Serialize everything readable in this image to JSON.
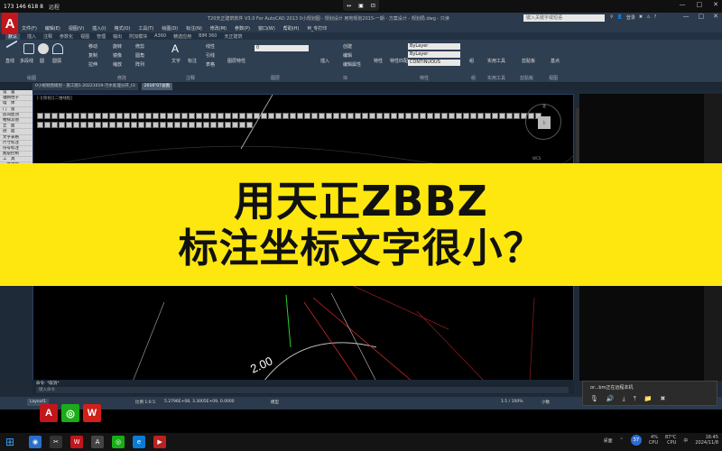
{
  "remote": {
    "id": "173 146 618 8",
    "tag": "远程",
    "center_icons": [
      "↔",
      "▣",
      "⊡"
    ],
    "panel_text": "or...bm正在远程本机",
    "panel_icons": [
      "🎙",
      "🔊",
      "⤓",
      "⤒",
      "📁",
      "✖"
    ]
  },
  "cad": {
    "logo": "A",
    "title": "T20天正建筑软件 V3.0 For AutoCAD 2013    0小规划图 - 规划设计 用地规划2015-一期 - 方案设计 - 规划局.dwg - 只读",
    "search_placeholder": "键入关键字或短语",
    "title_icons": [
      "⚲",
      "👤",
      "登录",
      "✖",
      "⚠",
      "?"
    ],
    "window_controls": [
      "—",
      "□",
      "✕"
    ],
    "menus": [
      "文件(F)",
      "编辑(E)",
      "视图(V)",
      "插入(I)",
      "格式(O)",
      "工具(T)",
      "绘图(D)",
      "标注(N)",
      "修改(M)",
      "参数(P)",
      "窗口(W)",
      "帮助(H)",
      "M_专打印"
    ],
    "ribbon_tabs": [
      "默认",
      "插入",
      "注释",
      "参数化",
      "视图",
      "管理",
      "输出",
      "附加模块",
      "A360",
      "精选应用",
      "BIM 360",
      "天正建筑"
    ],
    "ribbon": {
      "line": "直线",
      "polyline": "多段线",
      "circle": "圆",
      "arc": "圆弧",
      "move": "移动",
      "rotate": "旋转",
      "trim": "修剪",
      "copy": "复制",
      "mirror": "镜像",
      "fillet": "圆角",
      "stretch": "拉伸",
      "scale": "缩放",
      "array": "阵列",
      "text": "文字",
      "dim": "标注",
      "linear": "线性",
      "leader": "引线",
      "table": "表格",
      "layer_props": "图层特性",
      "layer_combo": "0",
      "insert": "插入",
      "create": "创建",
      "edit": "编辑",
      "edit_attr": "编辑属性",
      "props": "特性",
      "match": "特性匹配",
      "bylayer1": "ByLayer",
      "bylayer2": "ByLayer",
      "continuous": "CONTINUOUS",
      "group": "组",
      "utilities": "实用工具",
      "clipboard": "剪贴板",
      "base": "基点",
      "g_draw": "绘图",
      "g_modify": "修改",
      "g_annot": "注释",
      "g_layer": "图层",
      "g_block": "块",
      "g_props": "特性",
      "g_group": "组",
      "g_util": "实用工具",
      "g_clip": "剪贴板",
      "g_view": "视图"
    },
    "doc_tabs": [
      "0小规划图规划 - 施工图1-20221019-污水处理分开_t3",
      "2016\"07总图"
    ],
    "view_label": "[-][俯视][二维线框]",
    "viewcube_top": "上",
    "viewcube_north": "北",
    "wcs": "WCS",
    "palette": [
      "设　置",
      "轴网柱子",
      "墙　体",
      "门　窗",
      "房间屋顶",
      "楼梯其他",
      "立　面",
      "剖　面",
      "文字表格",
      "尺寸标注",
      "符号标注",
      "图层控制",
      "工　具",
      "三维建模",
      "图块图案",
      "文件布图",
      "其　它",
      "帮助演示"
    ],
    "annotation": "2.00",
    "cmd_history": "命令: *取消*",
    "cmd_placeholder": "键入命令",
    "layout_tab": "Layout1",
    "scale": "比例 1:0.5",
    "coords": "5.2796E+08, 3.3005E+09, 0.0000",
    "model_label": "模型",
    "anno_scale": "1:1 / 100%",
    "unit": "小数"
  },
  "banner": {
    "line1": "用天正ZBBZ",
    "line2": "标注坐标文字很小？"
  },
  "taskbar": {
    "desktop": "桌面",
    "badge": "37",
    "cpu": "4%",
    "cpu_label": "CPU",
    "temp": "87°C",
    "temp_label": "CPU",
    "ime": "中",
    "time": "16:45",
    "date": "2024/11/8"
  }
}
